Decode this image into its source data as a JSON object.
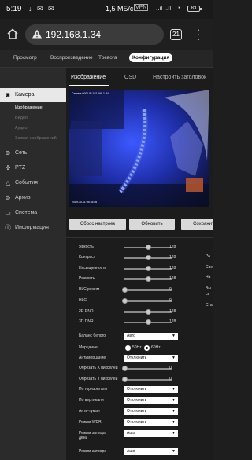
{
  "status_bar": {
    "time": "5:19",
    "icons": "↓ ✉ ✉ ·",
    "speed": "1,5 МБ/с",
    "net": "VPN",
    "signal": "..ıl ..ıl",
    "battery": "83"
  },
  "browser": {
    "url": "192.168.1.34",
    "tab_count": "21"
  },
  "top_nav": [
    "Просмотр",
    "Воспроизведение",
    "Тревога",
    "Конфигурация"
  ],
  "top_nav_active": "Конфигурация",
  "sidebar": {
    "camera": "Камера",
    "sub_items": [
      "Изображение",
      "Видео",
      "Аудио",
      "Захват изображений"
    ],
    "items": [
      "Сеть",
      "PTZ",
      "События",
      "Архив",
      "Система",
      "Информация"
    ]
  },
  "content_tabs": [
    "Изображение",
    "OSD",
    "Настроить заголовок"
  ],
  "video": {
    "osd_top": "Camera 0001 IP 192.168.1.34",
    "osd_bottom": "2019-10-11 05:18:56"
  },
  "buttons": {
    "reset": "Сброс настроек",
    "refresh": "Обновить",
    "save": "Сохранить"
  },
  "sliders": [
    {
      "label": "Яркость",
      "value": 128,
      "level": 0.5
    },
    {
      "label": "Контраст",
      "value": 128,
      "level": 0.5
    },
    {
      "label": "Насыщенность",
      "value": 128,
      "level": 0.5
    },
    {
      "label": "Резкость",
      "value": 128,
      "level": 0.5
    },
    {
      "label": "BLC режим",
      "value": 0,
      "level": 0
    },
    {
      "label": "HLC",
      "value": 0,
      "level": 0
    },
    {
      "label": "2D DNR",
      "value": 128,
      "level": 0.5
    },
    {
      "label": "3D DNR",
      "value": 128,
      "level": 0.5
    }
  ],
  "white_balance": {
    "label": "Баланс белого",
    "value": "Авто"
  },
  "flicker": {
    "label": "Мерцание",
    "opt1": "50Hz",
    "opt2": "60Hz",
    "selected": "60Hz"
  },
  "antiflicker": {
    "label": "Антимерцание",
    "value": "Отключить"
  },
  "crop_x": {
    "label": "Обрезать X пикселей",
    "value": 0
  },
  "crop_y": {
    "label": "Обрезать Y пикселей",
    "value": 0
  },
  "horizontal": {
    "label": "По горизонтали",
    "value": "Отключить"
  },
  "vertical": {
    "label": "По вертикали",
    "value": "Отключить"
  },
  "antifog": {
    "label": "Анти-туман",
    "value": "Отключить"
  },
  "wdr": {
    "label": "Режим WDR",
    "value": "Отключить"
  },
  "shutter_day": {
    "label1": "Режим затвора",
    "label2": "день",
    "value": "Auto"
  },
  "shutter_night": {
    "label": "Режим затвора",
    "value": "Auto"
  },
  "right_column": [
    "Ра",
    "Све",
    "Ни",
    "Вы",
    "св",
    "Ста"
  ]
}
